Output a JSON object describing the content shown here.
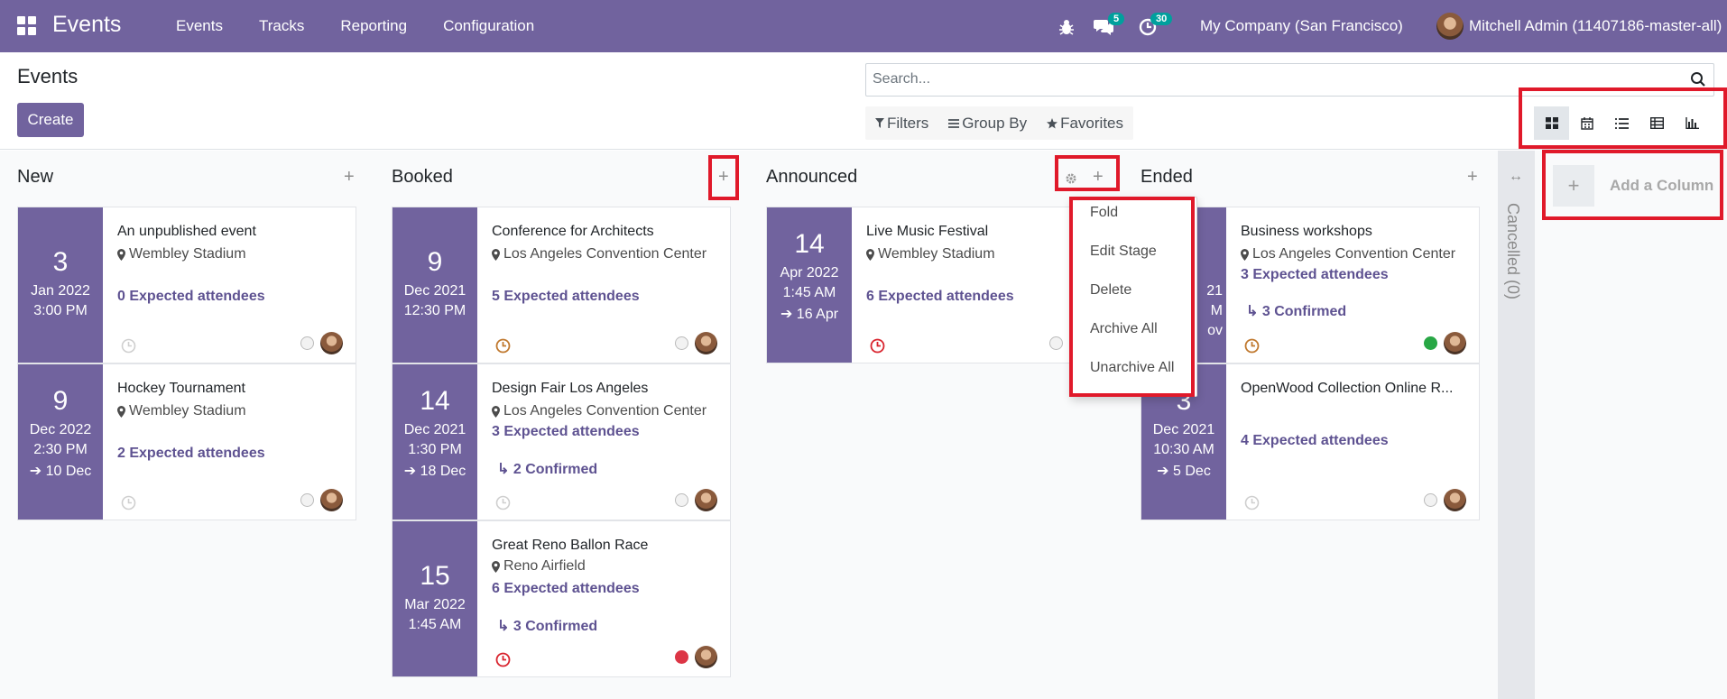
{
  "navbar": {
    "brand": "Events",
    "menu": [
      "Events",
      "Tracks",
      "Reporting",
      "Configuration"
    ],
    "chat_badge": "5",
    "activity_badge": "30",
    "company": "My Company (San Francisco)",
    "user": "Mitchell Admin (11407186-master-all)"
  },
  "control_panel": {
    "title": "Events",
    "create_label": "Create",
    "search_placeholder": "Search...",
    "filters_label": "Filters",
    "groupby_label": "Group By",
    "favorites_label": "Favorites",
    "views": [
      "kanban",
      "calendar",
      "list",
      "pivot",
      "graph"
    ],
    "active_view": "kanban"
  },
  "columns": [
    {
      "title": "New",
      "cards": [
        {
          "day": "3",
          "month": "Jan 2022",
          "time": "3:00 PM",
          "end": "",
          "title": "An unpublished event",
          "location": "Wembley Stadium",
          "attendees": "0 Expected attendees",
          "confirmed": "",
          "clock": "grey",
          "state": "grey"
        },
        {
          "day": "9",
          "month": "Dec 2022",
          "time": "2:30 PM",
          "end": "10 Dec",
          "title": "Hockey Tournament",
          "location": "Wembley Stadium",
          "attendees": "2 Expected attendees",
          "confirmed": "",
          "clock": "grey",
          "state": "grey"
        }
      ]
    },
    {
      "title": "Booked",
      "cards": [
        {
          "day": "9",
          "month": "Dec 2021",
          "time": "12:30 PM",
          "end": "",
          "title": "Conference for Architects",
          "location": "Los Angeles Convention Center",
          "attendees": "5 Expected attendees",
          "confirmed": "",
          "clock": "orange",
          "state": "grey"
        },
        {
          "day": "14",
          "month": "Dec 2021",
          "time": "1:30 PM",
          "end": "18 Dec",
          "title": "Design Fair Los Angeles",
          "location": "Los Angeles Convention Center",
          "attendees": "3 Expected attendees",
          "confirmed": "2 Confirmed",
          "clock": "grey",
          "state": "grey"
        },
        {
          "day": "15",
          "month": "Mar 2022",
          "time": "1:45 AM",
          "end": "",
          "title": "Great Reno Ballon Race",
          "location": "Reno Airfield",
          "attendees": "6 Expected attendees",
          "confirmed": "3 Confirmed",
          "clock": "red",
          "state": "red"
        }
      ]
    },
    {
      "title": "Announced",
      "cards": [
        {
          "day": "14",
          "month": "Apr 2022",
          "time": "1:45 AM",
          "end": "16 Apr",
          "title": "Live Music Festival",
          "location": "Wembley Stadium",
          "attendees": "6 Expected attendees",
          "confirmed": "",
          "clock": "red",
          "state": "grey"
        }
      ]
    },
    {
      "title": "Ended",
      "cards": [
        {
          "day": "",
          "month": "21",
          "time": "M",
          "end": "ov",
          "title": "Business workshops",
          "location": "Los Angeles Convention Center",
          "attendees": "3 Expected attendees",
          "confirmed": "3 Confirmed",
          "clock": "orange",
          "state": "green"
        },
        {
          "day": "3",
          "month": "Dec 2021",
          "time": "10:30 AM",
          "end": "5 Dec",
          "title": "OpenWood Collection Online R...",
          "location": "",
          "attendees": "4 Expected attendees",
          "confirmed": "",
          "clock": "grey",
          "state": "grey"
        }
      ]
    }
  ],
  "stage_menu": [
    "Fold",
    "Edit Stage",
    "Delete",
    "Archive All",
    "Unarchive All"
  ],
  "folded_column": "Cancelled (0)",
  "add_column_label": "Add a Column",
  "colors": {
    "primary": "#71639e",
    "badge": "#00a09d",
    "highlight": "#e0192a",
    "link": "#5e5291"
  }
}
